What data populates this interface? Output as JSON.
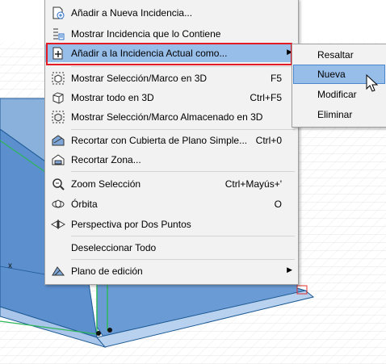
{
  "background": {
    "axis_label": "x",
    "colors": {
      "model_fill": "#4d84c9",
      "model_edge": "#1c5a94",
      "highlight_edge": "#2fb65b",
      "selection_marker": "#e03030"
    }
  },
  "main_menu": {
    "items": [
      {
        "label": "Añadir a Nueva Incidencia...",
        "shortcut": "",
        "icon": "new-issue-icon"
      },
      {
        "label": "Mostrar Incidencia que lo Contiene",
        "shortcut": "",
        "icon": "issue-list-icon"
      },
      {
        "label": "Añadir a la Incidencia Actual como...",
        "shortcut": "",
        "icon": "add-to-issue-icon",
        "has_submenu": true,
        "highlighted": true
      },
      {
        "label": "Mostrar Selección/Marco en 3D",
        "shortcut": "F5",
        "icon": "selection-3d-icon"
      },
      {
        "label": "Mostrar todo en 3D",
        "shortcut": "Ctrl+F5",
        "icon": "cube-icon"
      },
      {
        "label": "Mostrar Selección/Marco Almacenado en 3D",
        "shortcut": "",
        "icon": "stored-selection-3d-icon"
      },
      {
        "label": "Recortar con Cubierta de Plano Simple...",
        "shortcut": "Ctrl+0",
        "icon": "trim-roof-icon"
      },
      {
        "label": "Recortar Zona...",
        "shortcut": "",
        "icon": "trim-zone-icon"
      },
      {
        "label": "Zoom Selección",
        "shortcut": "Ctrl+Mayús+'",
        "icon": "zoom-selection-icon"
      },
      {
        "label": "Órbita",
        "shortcut": "O",
        "icon": "orbit-icon"
      },
      {
        "label": "Perspectiva por Dos Puntos",
        "shortcut": "",
        "icon": "two-point-perspective-icon"
      },
      {
        "label": "Deseleccionar Todo",
        "shortcut": "",
        "icon": ""
      },
      {
        "label": "Plano de edición",
        "shortcut": "",
        "icon": "editing-plane-icon",
        "has_submenu": true
      }
    ],
    "submenu_arrow": "▶"
  },
  "sub_menu": {
    "items": [
      {
        "label": "Resaltar"
      },
      {
        "label": "Nueva",
        "highlighted": true
      },
      {
        "label": "Modificar"
      },
      {
        "label": "Eliminar"
      }
    ]
  },
  "colors": {
    "menu_highlight": "#97bde9",
    "callout_border": "#e31b24",
    "menu_background": "#f2f2f2"
  }
}
